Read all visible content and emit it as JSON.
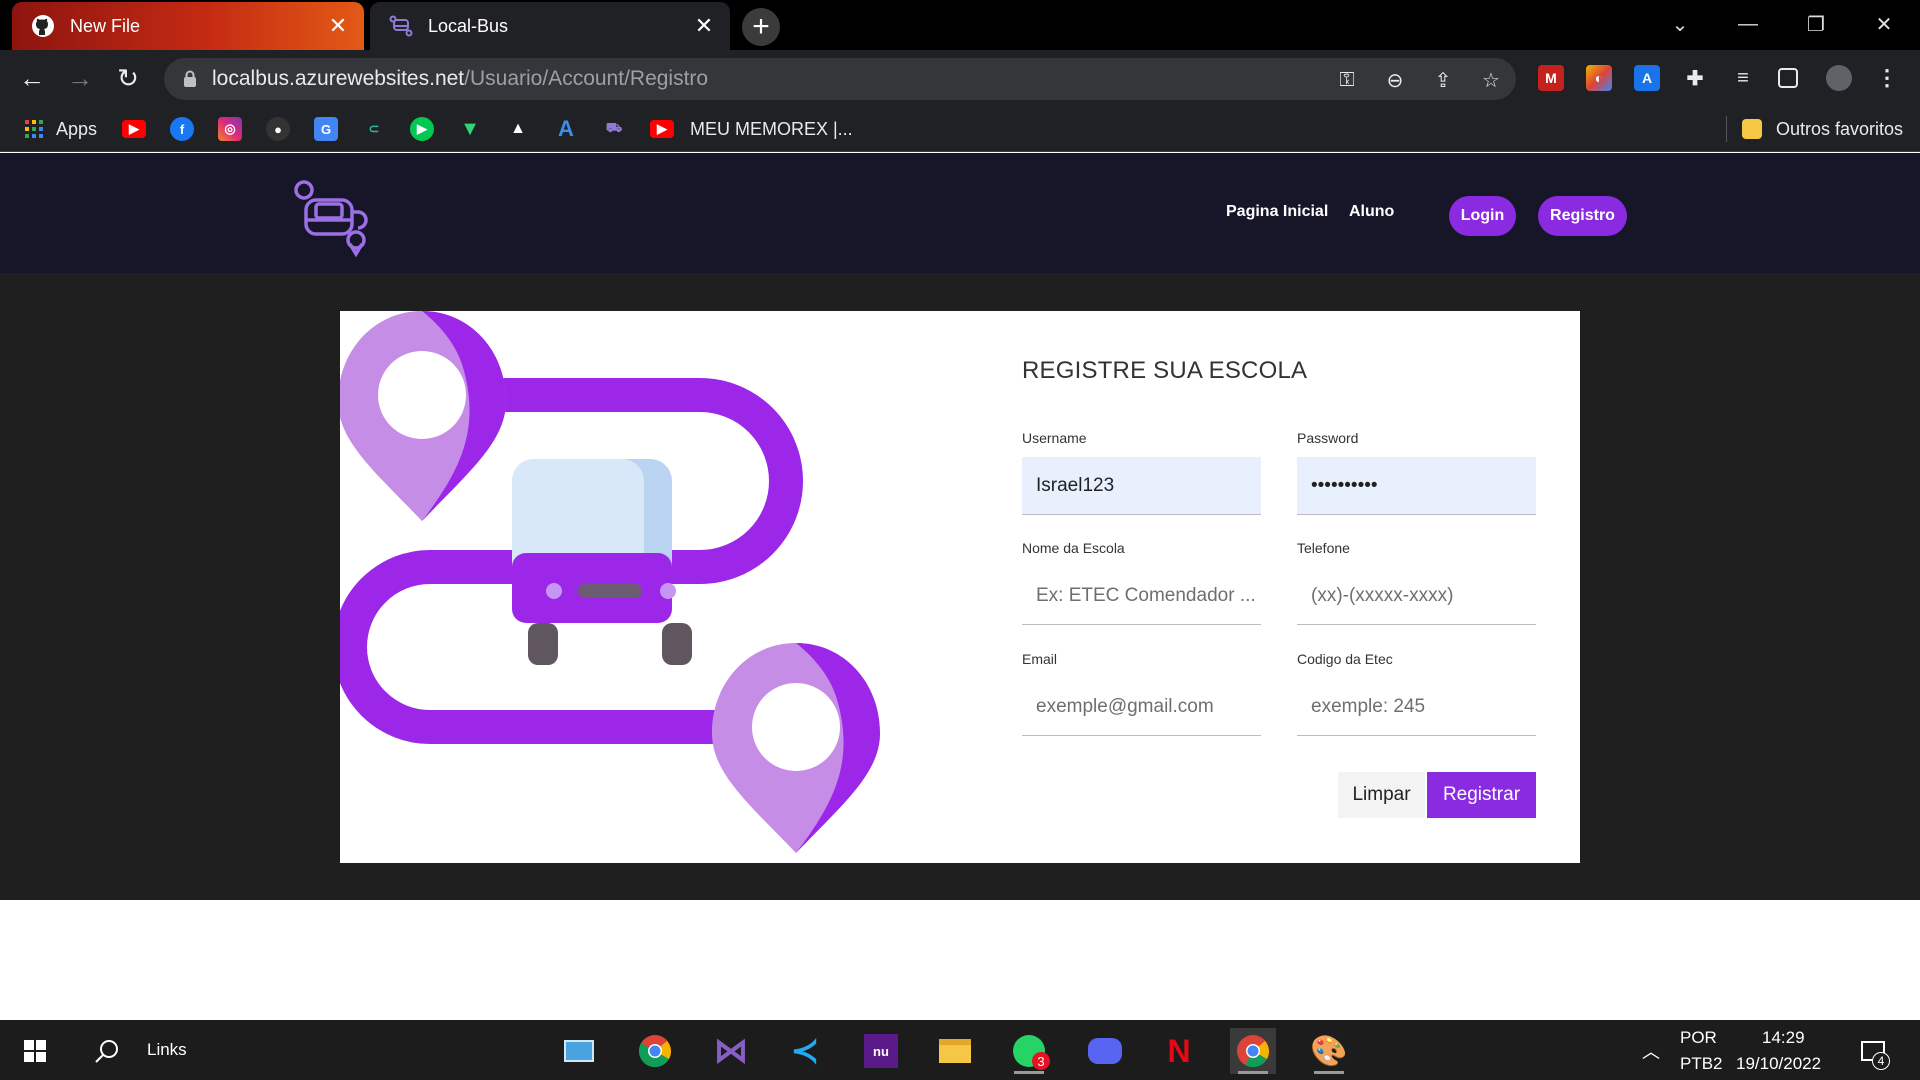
{
  "browser": {
    "tabs": [
      {
        "title": "New File",
        "icon": "github-icon"
      },
      {
        "title": "Local-Bus",
        "icon": "localbus-icon"
      }
    ],
    "address": {
      "host": "localbus.azurewebsites.net",
      "path": "/Usuario/Account/Registro"
    },
    "bookmarks": {
      "apps_label": "Apps",
      "memorex_label": "MEU MEMOREX |...",
      "outros_label": "Outros favoritos"
    }
  },
  "site": {
    "nav": {
      "home": "Pagina Inicial",
      "aluno": "Aluno",
      "login": "Login",
      "registro": "Registro"
    },
    "form": {
      "title": "REGISTRE SUA ESCOLA",
      "username": {
        "label": "Username",
        "value": "Israel123"
      },
      "password": {
        "label": "Password",
        "value": "••••••••••"
      },
      "escola": {
        "label": "Nome da Escola",
        "placeholder": "Ex: ETEC Comendador ..."
      },
      "telefone": {
        "label": "Telefone",
        "placeholder": "(xx)-(xxxxx-xxxx)"
      },
      "email": {
        "label": "Email",
        "placeholder": "exemple@gmail.com"
      },
      "codigo": {
        "label": "Codigo da Etec",
        "placeholder": "exemple: 245"
      },
      "limpar": "Limpar",
      "registrar": "Registrar"
    },
    "colors": {
      "accent": "#8a2be2",
      "header_bg": "#161628",
      "body_bg": "#1f1f1f"
    }
  },
  "taskbar": {
    "search_label": "Links",
    "whatsapp_badge": "3",
    "lang_line1": "POR",
    "lang_line2": "PTB2",
    "time": "14:29",
    "date": "19/10/2022",
    "notifications": "4"
  }
}
